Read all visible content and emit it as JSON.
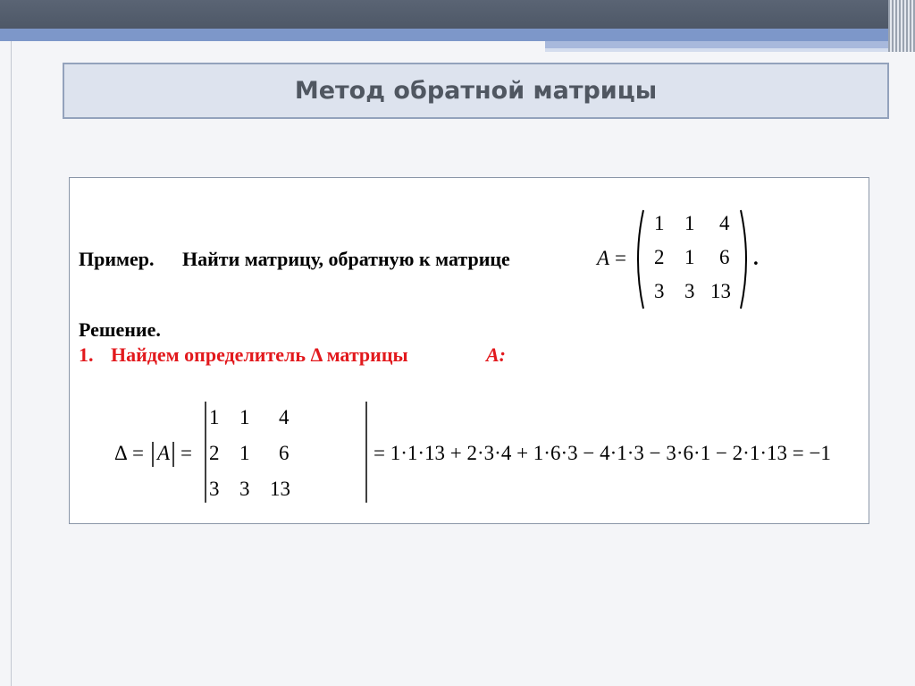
{
  "slide": {
    "title": "Метод обратной матрицы"
  },
  "example": {
    "label": "Пример.",
    "text": "Найти матрицу, обратную к матрице",
    "matrix_name": "A",
    "equals": "=",
    "period": ".",
    "matrix": [
      [
        "1",
        "1",
        "4"
      ],
      [
        "2",
        "1",
        "6"
      ],
      [
        "3",
        "3",
        "13"
      ]
    ]
  },
  "solution": {
    "label": "Решение.",
    "step1_number": "1.",
    "step1_text": "Найдем определитель Δ матрицы",
    "step1_var": "A:"
  },
  "determinant": {
    "delta": "Δ",
    "abs_a": "A",
    "det_matrix": [
      [
        "1",
        "1",
        "4"
      ],
      [
        "2",
        "1",
        "6"
      ],
      [
        "3",
        "3",
        "13"
      ]
    ],
    "expansion": "= 1·1·13 + 2·3·4 + 1·6·3 − 4·1·3 − 3·6·1 − 2·1·13 = −1"
  },
  "colors": {
    "header_bar": "#4e5867",
    "blue_band": "#7d97c9",
    "title_box_bg": "#dde3ee",
    "title_text": "#505761",
    "highlight_red": "#e2191d"
  }
}
